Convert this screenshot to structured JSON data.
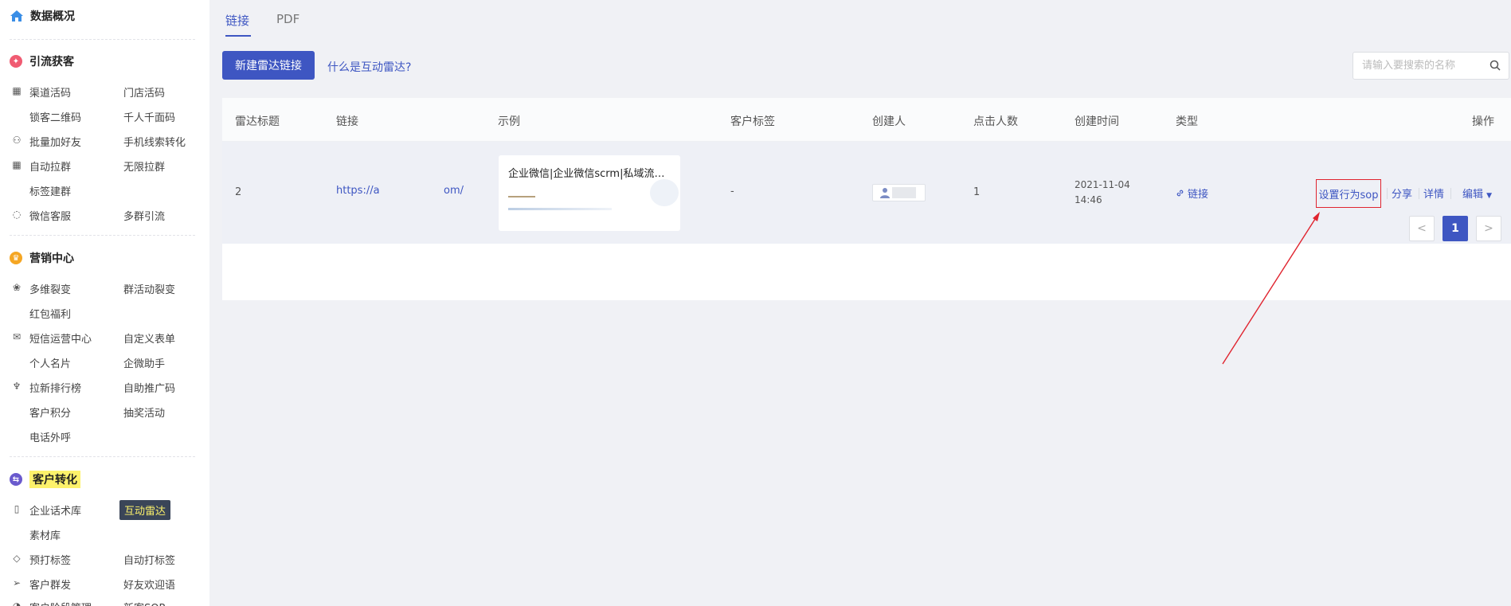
{
  "sidebar": {
    "sections": [
      {
        "title": "数据概况",
        "icon": "home-icon",
        "color": "#3a8ee6"
      },
      {
        "title": "引流获客",
        "icon": "badge-icon",
        "color": "#f05b72"
      },
      {
        "title": "营销中心",
        "icon": "trophy-icon",
        "color": "#f5a623"
      },
      {
        "title": "客户转化",
        "icon": "transfer-icon",
        "color": "#6a5acd"
      }
    ],
    "acquisition_items": [
      [
        "渠道活码",
        "门店活码"
      ],
      [
        "锁客二维码",
        "千人千面码"
      ],
      [
        "批量加好友",
        "手机线索转化"
      ],
      [
        "自动拉群",
        "无限拉群"
      ],
      [
        "标签建群",
        ""
      ],
      [
        "微信客服",
        "多群引流"
      ]
    ],
    "marketing_items": [
      [
        "多维裂变",
        "群活动裂变"
      ],
      [
        "红包福利",
        ""
      ],
      [
        "短信运营中心",
        "自定义表单"
      ],
      [
        "个人名片",
        "企微助手"
      ],
      [
        "拉新排行榜",
        "自助推广码"
      ],
      [
        "客户积分",
        "抽奖活动"
      ],
      [
        "电话外呼",
        ""
      ]
    ],
    "conversion_items": [
      [
        "企业话术库",
        "互动雷达"
      ],
      [
        "素材库",
        ""
      ],
      [
        "预打标签",
        "自动打标签"
      ],
      [
        "客户群发",
        "好友欢迎语"
      ],
      [
        "客户阶段管理",
        "新客SOP"
      ]
    ]
  },
  "tabs": [
    "链接",
    "PDF"
  ],
  "toolbar": {
    "new_button": "新建雷达链接",
    "help_link": "什么是互动雷达?",
    "search_placeholder": "请输入要搜索的名称"
  },
  "table": {
    "headers": [
      "雷达标题",
      "链接",
      "示例",
      "客户标签",
      "创建人",
      "点击人数",
      "创建时间",
      "类型",
      "操作"
    ],
    "rows": [
      {
        "title": "2",
        "link_start": "https://a",
        "link_end": "om/",
        "preview_title": "企业微信|企业微信scrm|私域流量|...",
        "tags": "-",
        "clicks": "1",
        "created_date": "2021-11-04",
        "created_time": "14:46",
        "type": "链接",
        "actions": {
          "sop": "设置行为sop",
          "share": "分享",
          "detail": "详情",
          "edit": "编辑"
        }
      }
    ]
  },
  "pagination": {
    "prev": "<",
    "current": "1",
    "next": ">"
  },
  "colors": {
    "accent": "#3e56c2",
    "highlight_border": "#e0242f",
    "highlight_text": "#fdf26b"
  }
}
